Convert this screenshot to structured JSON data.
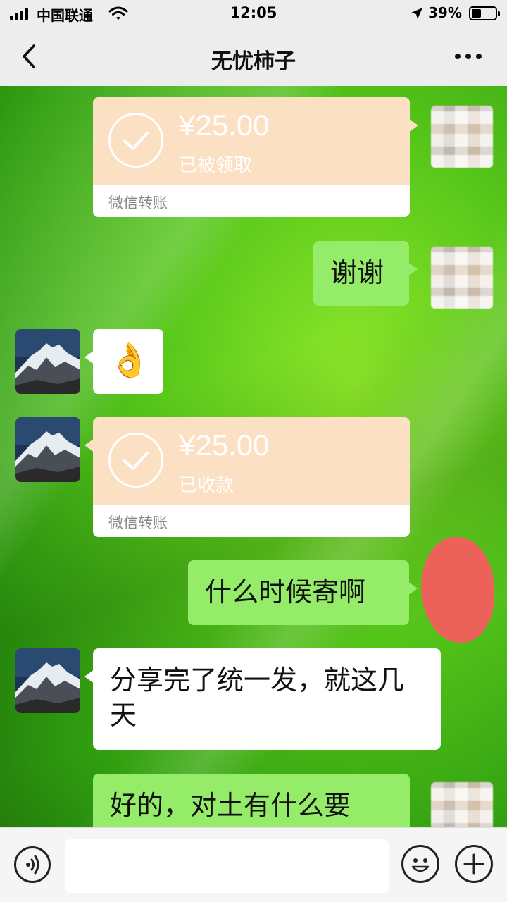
{
  "status_bar": {
    "carrier": "中国联通",
    "time": "12:05",
    "battery": "39%"
  },
  "nav": {
    "title": "无忧柿子"
  },
  "messages": [
    {
      "type": "transfer",
      "side": "right",
      "amount": "¥25.00",
      "status": "已被领取",
      "footer": "微信转账"
    },
    {
      "type": "text",
      "side": "right",
      "text": "谢谢"
    },
    {
      "type": "emoji",
      "side": "left",
      "emoji": "👌"
    },
    {
      "type": "transfer",
      "side": "left",
      "amount": "¥25.00",
      "status": "已收款",
      "footer": "微信转账"
    },
    {
      "type": "text",
      "side": "right",
      "text": "什么时候寄啊"
    },
    {
      "type": "text",
      "side": "left",
      "text": "分享完了统一发，就这几天"
    },
    {
      "type": "text",
      "side": "right",
      "text": "好的，对土有什么要"
    }
  ],
  "colors": {
    "sent_bubble": "#95ec69",
    "received_bubble": "#ffffff",
    "transfer_card": "#fbe0c4",
    "wallpaper": "#56c61a"
  },
  "icons": [
    "signal-icon",
    "wifi-icon",
    "location-icon",
    "battery-icon",
    "back-icon",
    "more-icon",
    "voice-icon",
    "emoji-icon",
    "plus-icon"
  ]
}
